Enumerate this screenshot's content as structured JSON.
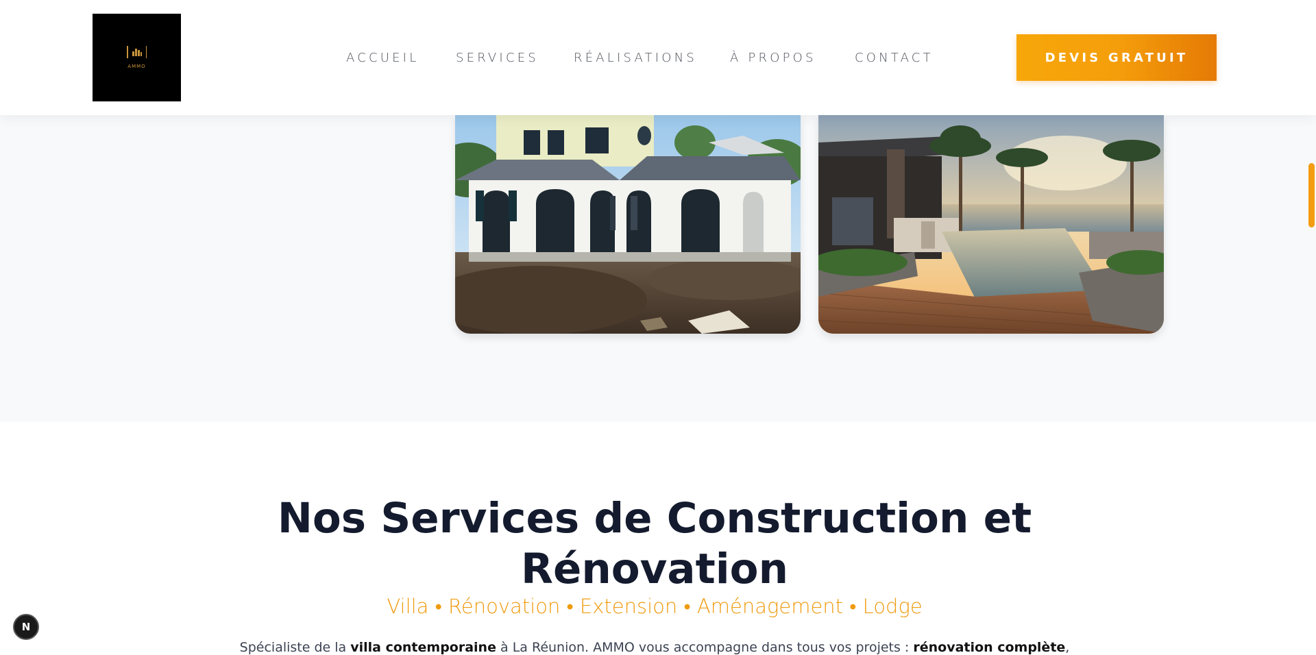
{
  "logo": {
    "text": "AMMO"
  },
  "nav": {
    "items": [
      "ACCUEIL",
      "SERVICES",
      "RÉALISATIONS",
      "À PROPOS",
      "CONTACT"
    ],
    "cta_label": "DEVIS GRATUIT"
  },
  "gallery": {
    "images": [
      "Villa en construction à La Réunion",
      "Villa contemporaine avec piscine à débordement"
    ]
  },
  "services": {
    "title_line1": "Nos Services de Construction et",
    "title_line2": "Rénovation",
    "subtitle": "Villa • Rénovation • Extension • Aménagement • Lodge",
    "intro_part1": "Spécialiste de la ",
    "intro_bold1": "villa contemporaine",
    "intro_part2": " à La Réunion. AMMO vous accompagne dans tous vos projets : ",
    "intro_bold2": "rénovation complète",
    "intro_part3": ","
  },
  "badge": {
    "label": "N"
  },
  "colors": {
    "accent": "#f59e0b",
    "title": "#141b2e",
    "nav": "#4b4f58"
  }
}
